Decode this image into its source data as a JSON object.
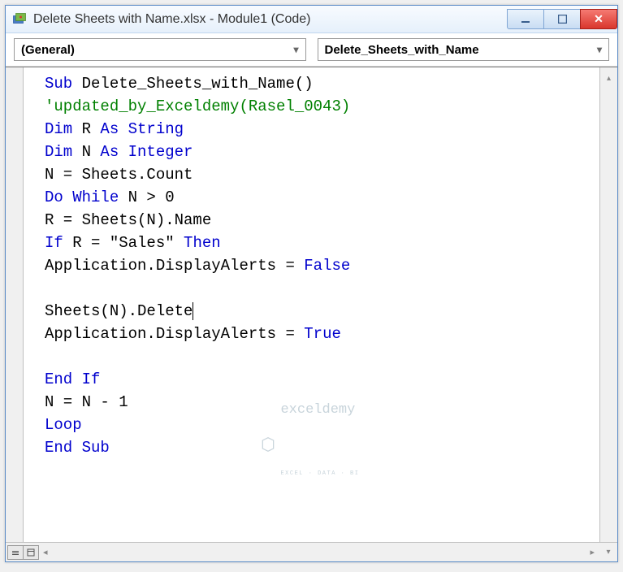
{
  "window": {
    "title": "Delete Sheets with Name.xlsx - Module1 (Code)"
  },
  "dropdowns": {
    "left": "(General)",
    "right": "Delete_Sheets_with_Name"
  },
  "code": {
    "l1_kw": "Sub ",
    "l1_txt": "Delete_Sheets_with_Name()",
    "l2_cm": "'updated_by_Exceldemy(Rasel_0043)",
    "l3_kw": "Dim ",
    "l3_txt": "R ",
    "l3_kw2": "As String",
    "l4_kw": "Dim ",
    "l4_txt": "N ",
    "l4_kw2": "As Integer",
    "l5_txt": "N = Sheets.Count",
    "l6_kw": "Do While ",
    "l6_txt": "N > 0",
    "l7_txt": "R = Sheets(N).Name",
    "l8_kw": "If ",
    "l8_txt": "R = \"Sales\" ",
    "l8_kw2": "Then",
    "l9_txt": "Application.DisplayAlerts = ",
    "l9_kw": "False",
    "l10_txt": "Sheets(N).Delete",
    "l11_txt": "Application.DisplayAlerts = ",
    "l11_kw": "True",
    "l12_kw": "End If",
    "l13_txt": "N = N - 1",
    "l14_kw": "Loop",
    "l15_kw": "End Sub"
  },
  "watermark": {
    "brand": "exceldemy",
    "tagline": "EXCEL · DATA · BI"
  }
}
